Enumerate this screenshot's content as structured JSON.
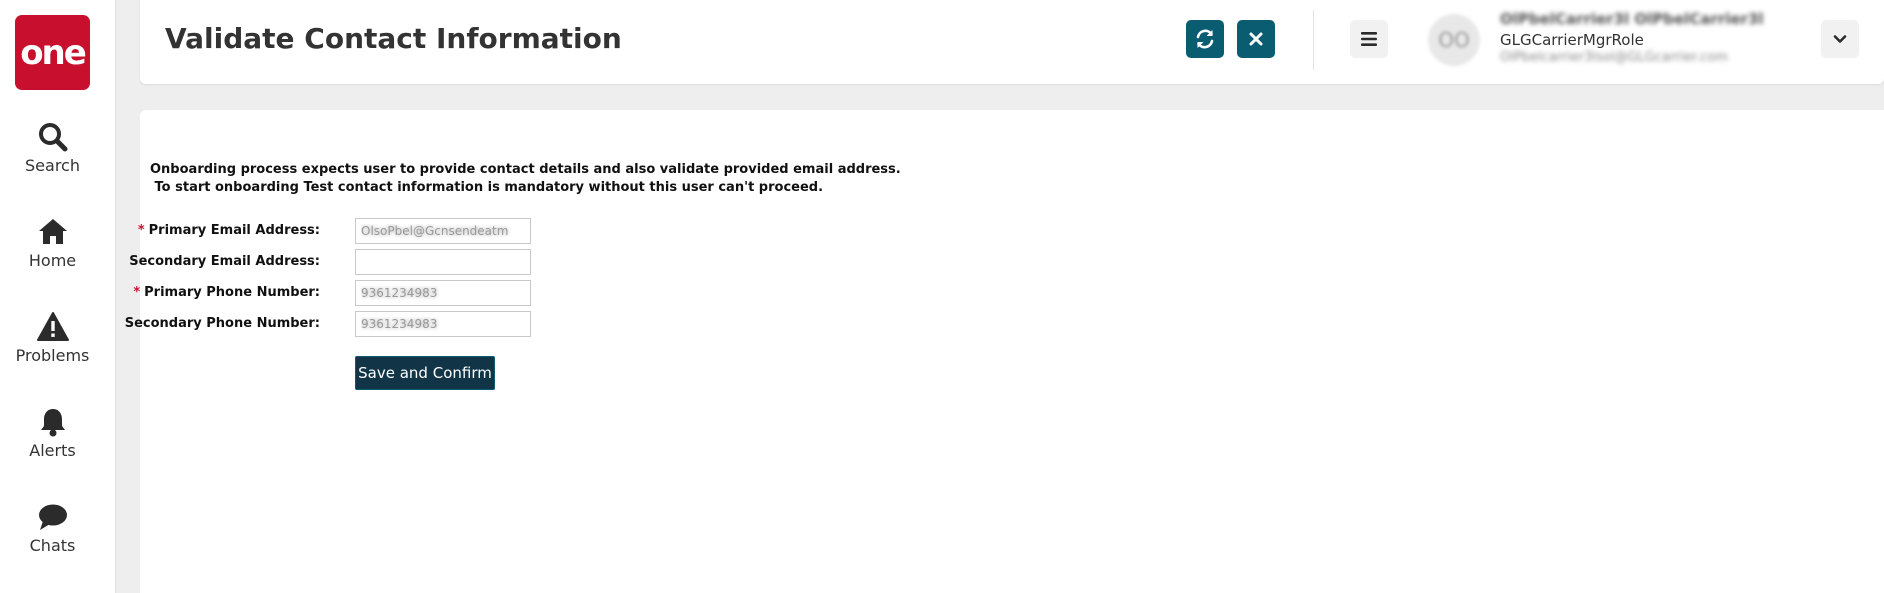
{
  "sidebar": {
    "logo_text": "one",
    "items": [
      {
        "label": "Search",
        "icon": "search-icon"
      },
      {
        "label": "Home",
        "icon": "home-icon"
      },
      {
        "label": "Problems",
        "icon": "warning-icon"
      },
      {
        "label": "Alerts",
        "icon": "bell-icon"
      },
      {
        "label": "Chats",
        "icon": "chat-icon"
      }
    ]
  },
  "header": {
    "title": "Validate Contact Information",
    "refresh_icon": "refresh-icon",
    "close_icon": "close-icon",
    "menu_icon": "hamburger-menu-icon",
    "user": {
      "avatar_initials": "OO",
      "name": "OlPbelCarrier3l OlPbelCarrier3l",
      "role": "GLGCarrierMgrRole",
      "email": "OlPbelcarrier3lsol@GLGcarrier.com"
    },
    "dropdown_icon": "chevron-down-icon"
  },
  "form": {
    "intro_line1": "Onboarding process expects user to provide contact details and also validate provided email address.",
    "intro_line2": " To start onboarding Test contact information is mandatory without this user can't proceed.",
    "required_marker": "*",
    "fields": {
      "primary_email": {
        "label": "Primary Email Address:",
        "required": true,
        "value": "OlsoPbel@Gcnsendeatm"
      },
      "secondary_email": {
        "label": "Secondary Email Address:",
        "required": false,
        "value": ""
      },
      "primary_phone": {
        "label": "Primary Phone Number:",
        "required": true,
        "value": "9361234983"
      },
      "secondary_phone": {
        "label": "Secondary Phone Number:",
        "required": false,
        "value": "9361234983"
      }
    },
    "submit_label": "Save and Confirm"
  },
  "colors": {
    "brand_red": "#c8102e",
    "header_button": "#0a5d71",
    "submit_button": "#113547",
    "background": "#eeeeee"
  }
}
